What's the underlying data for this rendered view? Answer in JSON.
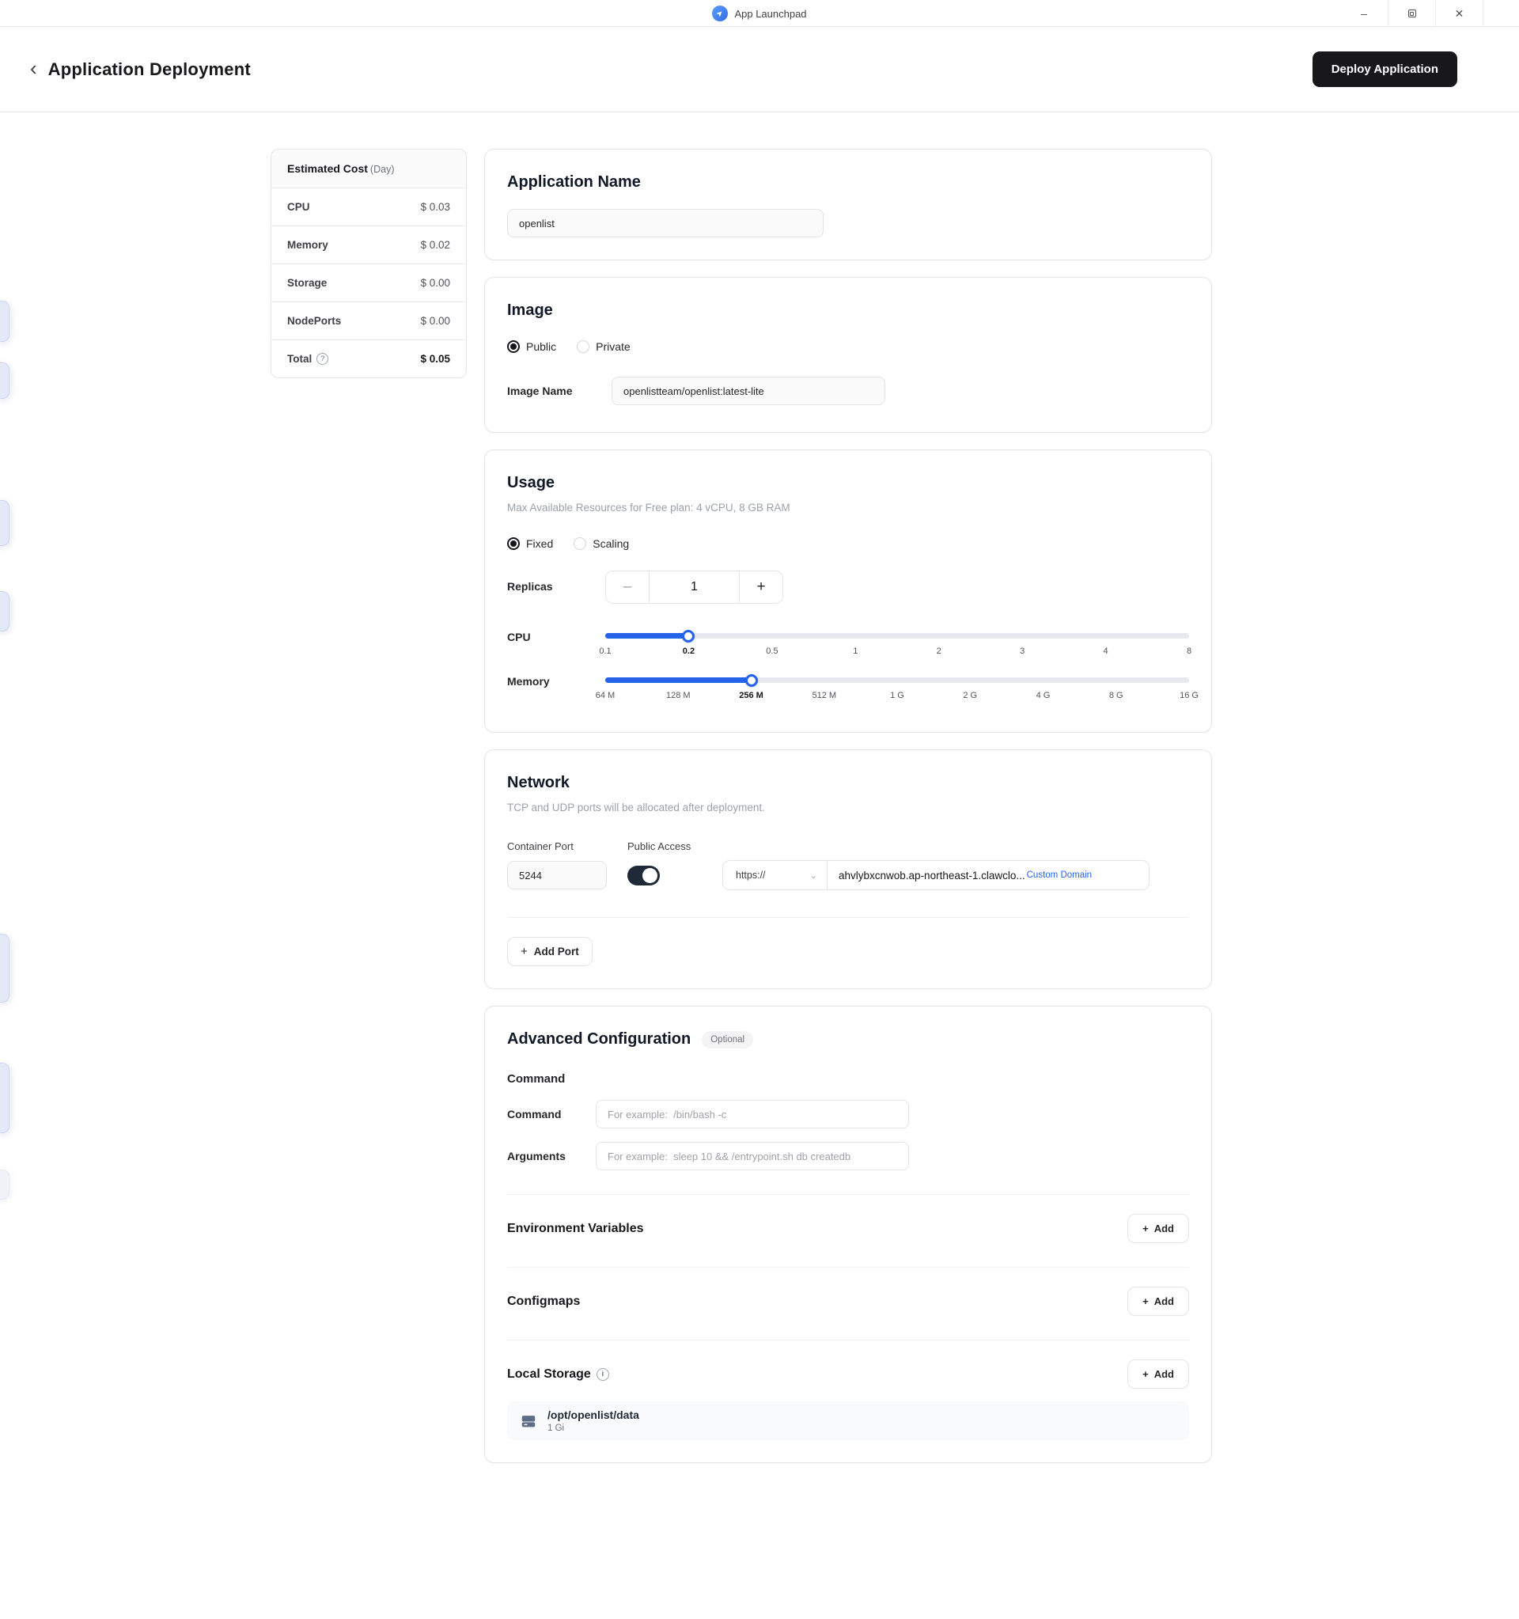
{
  "titlebar": {
    "app_title": "App Launchpad"
  },
  "icons": {
    "app_logo": "➤",
    "minimize": "–",
    "close": "✕",
    "back": "‹",
    "chevron_down": "⌄",
    "plus": "+",
    "minus": "–",
    "help": "?",
    "info": "i"
  },
  "header": {
    "title": "Application Deployment",
    "deploy_button": "Deploy Application"
  },
  "cost_panel": {
    "title": "Estimated Cost",
    "period": "(Day)",
    "rows": [
      {
        "label": "CPU",
        "value": "$ 0.03"
      },
      {
        "label": "Memory",
        "value": "$ 0.02"
      },
      {
        "label": "Storage",
        "value": "$ 0.00"
      },
      {
        "label": "NodePorts",
        "value": "$ 0.00"
      }
    ],
    "total": {
      "label": "Total",
      "value": "$ 0.05"
    }
  },
  "app_name": {
    "title": "Application Name",
    "value": "openlist"
  },
  "image": {
    "title": "Image",
    "options": [
      "Public",
      "Private"
    ],
    "selected": "Public",
    "image_name_label": "Image Name",
    "image_name_value": "openlistteam/openlist:latest-lite"
  },
  "usage": {
    "title": "Usage",
    "subtitle": "Max Available Resources for Free plan: 4 vCPU, 8 GB RAM",
    "modes": [
      "Fixed",
      "Scaling"
    ],
    "selected_mode": "Fixed",
    "replicas": {
      "label": "Replicas",
      "value": "1"
    },
    "cpu": {
      "label": "CPU",
      "ticks": [
        "0.1",
        "0.2",
        "0.5",
        "1",
        "2",
        "3",
        "4",
        "8"
      ],
      "selected_index": 1,
      "selected": "0.2"
    },
    "memory": {
      "label": "Memory",
      "ticks": [
        "64 M",
        "128 M",
        "256 M",
        "512 M",
        "1 G",
        "2 G",
        "4 G",
        "8 G",
        "16 G"
      ],
      "selected_index": 2,
      "selected": "256 M"
    }
  },
  "network": {
    "title": "Network",
    "subtitle": "TCP and UDP ports will be allocated after deployment.",
    "container_port_label": "Container Port",
    "container_port_value": "5244",
    "public_access_label": "Public Access",
    "public_access_enabled": true,
    "protocol": "https://",
    "domain": "ahvlybxcnwob.ap-northeast-1.clawclo...",
    "custom_domain_label": "Custom Domain",
    "add_port_label": "Add Port"
  },
  "advanced": {
    "title": "Advanced Configuration",
    "badge": "Optional",
    "command_section_title": "Command",
    "command_label": "Command",
    "command_placeholder": "For example:  /bin/bash -c",
    "arguments_label": "Arguments",
    "arguments_placeholder": "For example:  sleep 10 && /entrypoint.sh db createdb",
    "env_label": "Environment Variables",
    "configmaps_label": "Configmaps",
    "local_storage_label": "Local Storage",
    "add_label": "Add",
    "storage_item": {
      "path": "/opt/openlist/data",
      "size": "1 Gi"
    }
  },
  "colors": {
    "accent_blue": "#2563eb",
    "toggle_on": "#1f2937",
    "deploy_button_bg": "#18181b",
    "link_blue": "#2563eb"
  }
}
